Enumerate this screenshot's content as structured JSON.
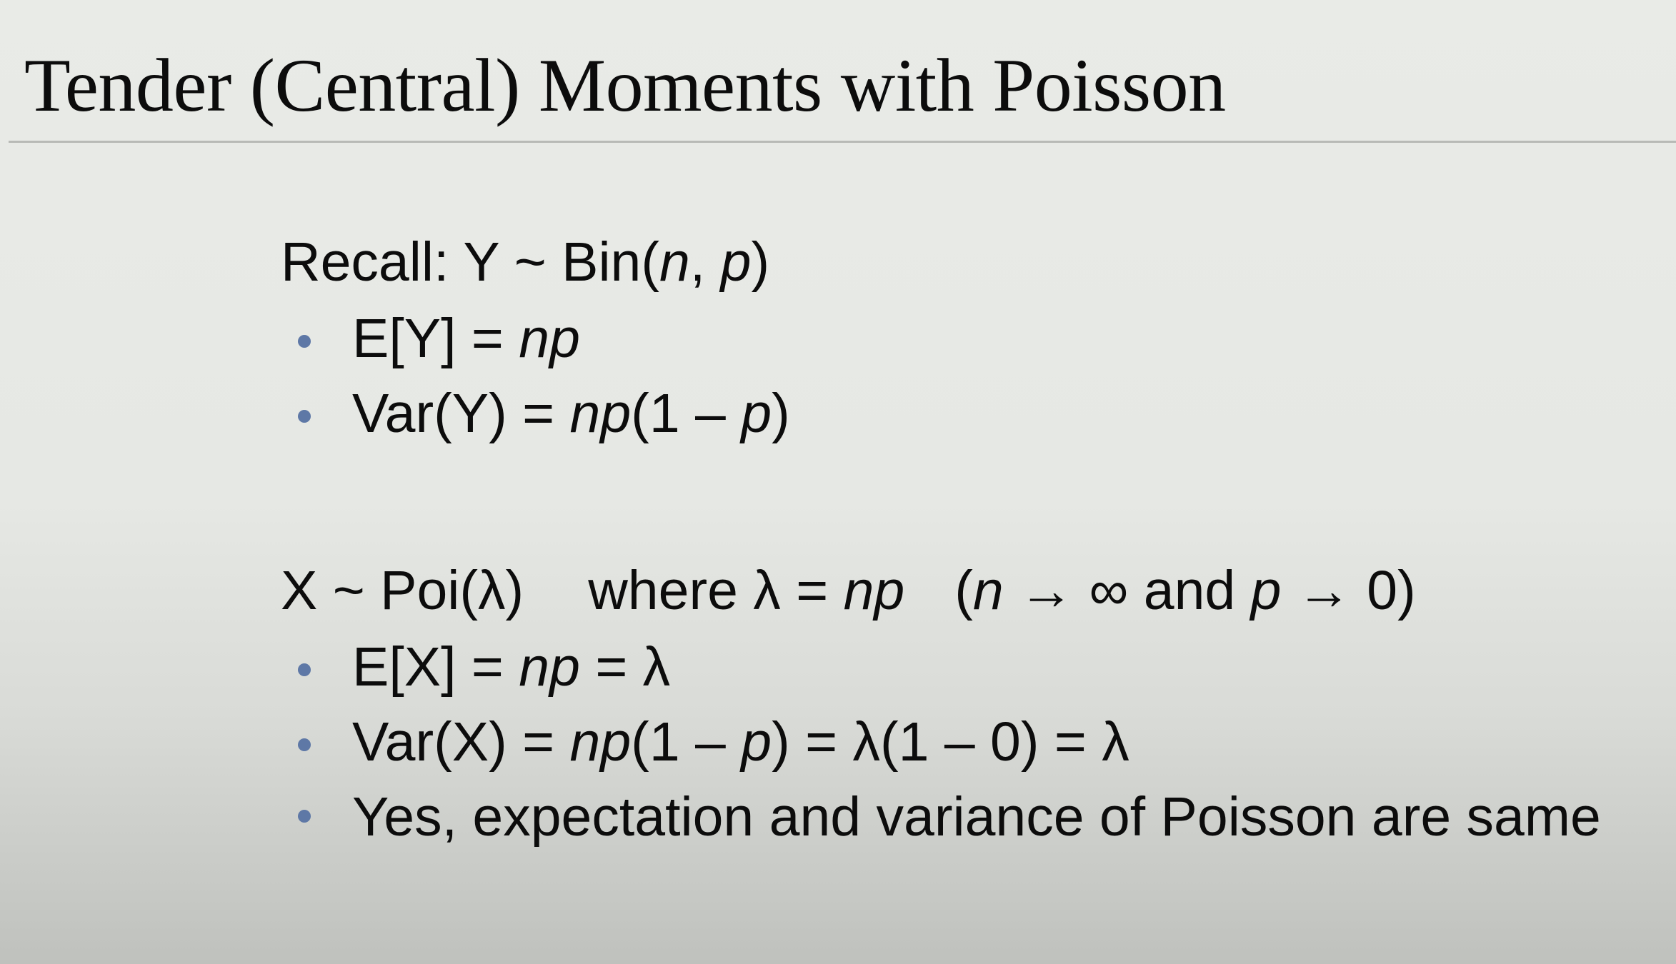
{
  "slide": {
    "title": "Tender (Central) Moments with Poisson"
  },
  "binomial": {
    "heading_prefix": "Recall: Y ~ Bin(",
    "heading_n": "n",
    "heading_sep": ", ",
    "heading_p": "p",
    "heading_suffix": ")",
    "expectation": {
      "lhs": "E[Y] = ",
      "rhs": "np"
    },
    "variance": {
      "lhs": "Var(Y) = ",
      "np": "np",
      "mid": "(1 – ",
      "p": "p",
      "end": ")"
    }
  },
  "poisson": {
    "heading_main": "X ~ Poi(λ)",
    "heading_where": "where λ = ",
    "heading_np": "np",
    "heading_cond_open": "(",
    "heading_cond_n": "n",
    "heading_cond_mid": " → ∞ and ",
    "heading_cond_p": "p",
    "heading_cond_end": " → 0)",
    "expectation": {
      "lhs": "E[X] = ",
      "np": "np",
      "rhs": " = λ"
    },
    "variance": {
      "lhs": "Var(X) = ",
      "np": "np",
      "mid": "(1 – ",
      "p": "p",
      "rhs": ") = λ(1 – 0) = λ"
    },
    "conclusion": "Yes, expectation and variance of Poisson are same"
  },
  "colors": {
    "bullet": "#5e78a6",
    "text": "#0c0c0c",
    "rule": "#b8bab6"
  }
}
